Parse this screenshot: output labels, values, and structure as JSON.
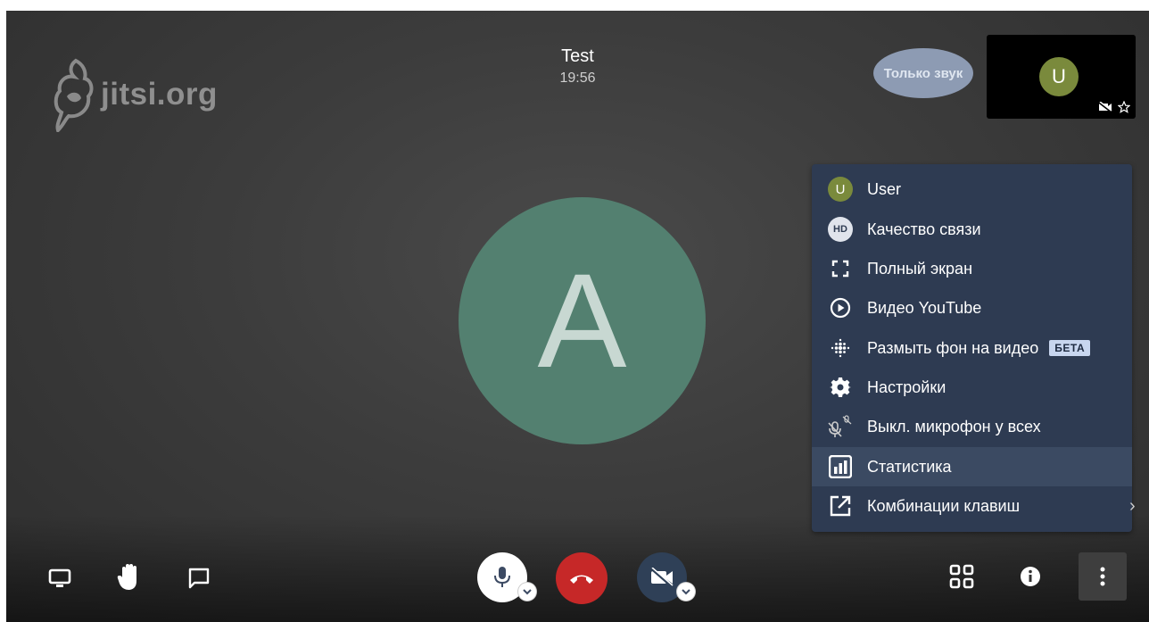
{
  "logo": {
    "text": "jitsi.org"
  },
  "conference": {
    "title": "Test",
    "time": "19:56"
  },
  "audio_only_label": "Только звук",
  "local_thumbnail": {
    "initial": "U"
  },
  "main_avatar": {
    "initial": "A"
  },
  "overflow_menu": {
    "items": [
      {
        "label": "User",
        "icon": "user-avatar-icon",
        "avatar_initial": "U"
      },
      {
        "label": "Качество связи",
        "icon": "hd-icon",
        "badge": "HD"
      },
      {
        "label": "Полный экран",
        "icon": "fullscreen-icon"
      },
      {
        "label": "Видео YouTube",
        "icon": "play-circle-icon"
      },
      {
        "label": "Размыть фон на видео",
        "icon": "blur-icon",
        "tag": "БЕТА"
      },
      {
        "label": "Настройки",
        "icon": "gear-icon"
      },
      {
        "label": "Выкл. микрофон у всех",
        "icon": "mute-everyone-icon"
      },
      {
        "label": "Статистика",
        "icon": "stats-icon",
        "active": true
      },
      {
        "label": "Комбинации клавиш",
        "icon": "open-in-new-icon"
      }
    ]
  },
  "colors": {
    "menu_bg": "#2e3b52",
    "menu_active": "#3b4a62",
    "hangup": "#c62828",
    "avatar_main": "#538070",
    "avatar_user": "#7a8a3c"
  }
}
